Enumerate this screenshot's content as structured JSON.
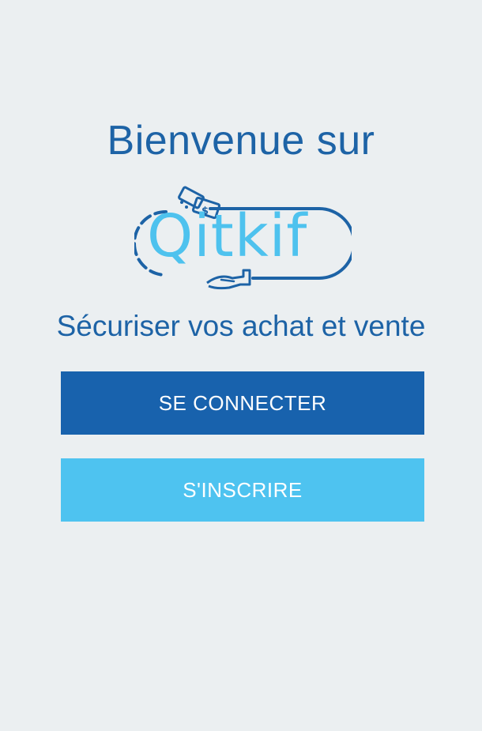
{
  "welcome": {
    "title": "Bienvenue sur"
  },
  "logo": {
    "text": "Qitkif",
    "icons": [
      "banknote-hand-icon",
      "receiving-hand-icon"
    ],
    "colors": {
      "dark": "#1d63a6",
      "light": "#4ec2ee"
    }
  },
  "tagline": "Sécuriser vos achat et vente",
  "buttons": {
    "login_label": "SE CONNECTER",
    "signup_label": "S'INSCRIRE"
  },
  "colors": {
    "background": "#ebeff1",
    "primary": "#1862ad",
    "secondary": "#4ec3f0"
  }
}
